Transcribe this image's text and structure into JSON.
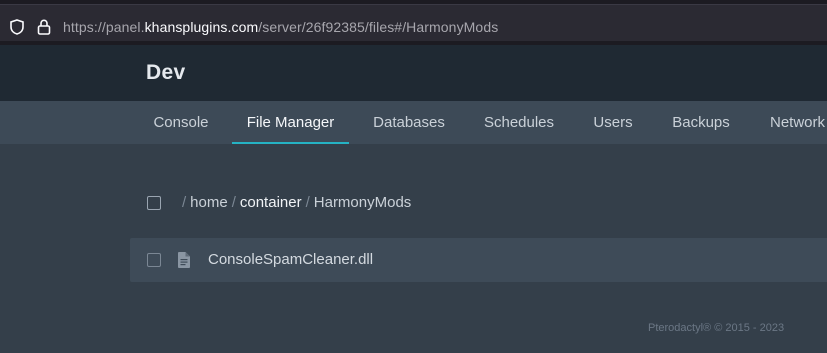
{
  "browser": {
    "url_prefix": "https://panel.",
    "url_host": "khansplugins.com",
    "url_path": "/server/26f92385/files#/HarmonyMods"
  },
  "server": {
    "name": "Dev"
  },
  "tabs": [
    {
      "label": "Console",
      "active": false
    },
    {
      "label": "File Manager",
      "active": true
    },
    {
      "label": "Databases",
      "active": false
    },
    {
      "label": "Schedules",
      "active": false
    },
    {
      "label": "Users",
      "active": false
    },
    {
      "label": "Backups",
      "active": false
    },
    {
      "label": "Network",
      "active": false
    }
  ],
  "breadcrumb": {
    "sep": "/",
    "segments": [
      "home",
      "container",
      "HarmonyMods"
    ]
  },
  "files": [
    {
      "name": "ConsoleSpamCleaner.dll",
      "type": "file"
    }
  ],
  "footer": {
    "text": "Pterodactyl® © 2015 - 2023"
  },
  "colors": {
    "accent": "#25b3c4",
    "background": "#343f4a",
    "header": "#1f2933"
  }
}
